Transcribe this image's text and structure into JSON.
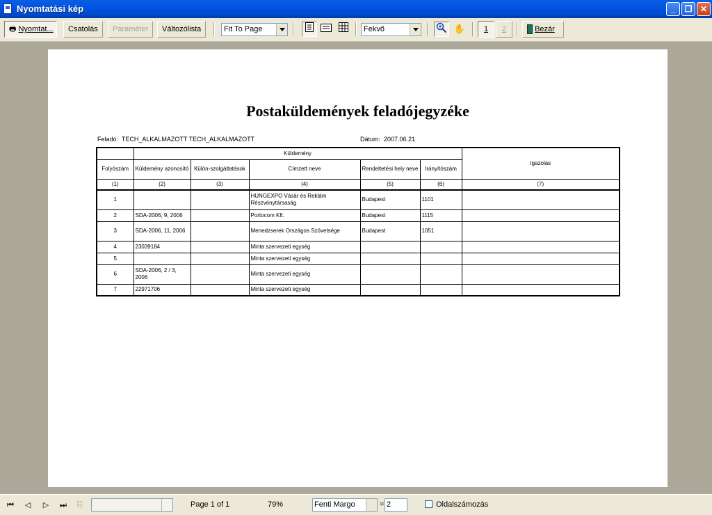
{
  "window": {
    "title": "Nyomtatási kép"
  },
  "toolbar": {
    "print_label": "Nyomtat...",
    "attach_label": "Csatolás",
    "param_label": "Paraméter",
    "varlist_label": "Változólista",
    "zoom_mode": "Fit To Page",
    "orientation": "Fekvő",
    "page1": "1",
    "page2": "2",
    "close_label": "Bezár"
  },
  "report": {
    "title": "Postaküldemények feladójegyzéke",
    "sender_label": "Feladó:",
    "sender": "TECH_ALKALMAZOTT TECH_ALKALMAZOTT",
    "date_label": "Dátum:",
    "date": "2007.06.21",
    "group_header": "Küldemény",
    "headers": [
      "Folyószám",
      "Küldemény azonosító",
      "Külön-szolgáltatások",
      "Címzett neve",
      "Rendeltetési hely neve",
      "Irányítószám",
      "Igazolás"
    ],
    "col_numbers": [
      "(1)",
      "(2)",
      "(3)",
      "(4)",
      "(5)",
      "(6)",
      "(7)"
    ],
    "rows": [
      [
        "1",
        "",
        "",
        "HUNGEXPO Vásár és Reklám Részvénytársaság",
        "Budapest",
        "1101",
        ""
      ],
      [
        "2",
        "SDA-2006, 9, 2006",
        "",
        "Portocom Kft.",
        "Budapest",
        "1115",
        ""
      ],
      [
        "3",
        "SDA-2006, 11, 2006",
        "",
        "Menedzserek Országos Szövetsége",
        "Budapest",
        "1051",
        ""
      ],
      [
        "4",
        "23039184",
        "",
        "Minta szervezeti egység",
        "",
        "",
        ""
      ],
      [
        "5",
        "",
        "",
        "Minta szervezeti egység",
        "",
        "",
        ""
      ],
      [
        "6",
        "SDA-2006, 2 / 3, 2006",
        "",
        "Minta szervezeti egység",
        "",
        "",
        ""
      ],
      [
        "7",
        "22971706",
        "",
        "Minta szervezeti egység",
        "",
        "",
        ""
      ]
    ]
  },
  "statusbar": {
    "page_info": "Page 1 of 1",
    "zoom": "79%",
    "margin_select": "Fenti Margo",
    "equals": "=",
    "margin_value": "2",
    "page_numbering_label": "Oldalszámozás"
  },
  "colors": {
    "titlebar": "#0054e3",
    "workspace": "#aca899",
    "chrome": "#ece9d8"
  }
}
